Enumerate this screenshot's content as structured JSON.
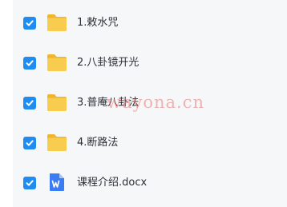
{
  "files": [
    {
      "name": "1.敕水咒",
      "type": "folder",
      "checked": true
    },
    {
      "name": "2.八卦镜开光",
      "type": "folder",
      "checked": true
    },
    {
      "name": "3.普庵八卦法",
      "type": "folder",
      "checked": true
    },
    {
      "name": "4.断路法",
      "type": "folder",
      "checked": true
    },
    {
      "name": "课程介绍.docx",
      "type": "word-document",
      "checked": true
    }
  ],
  "icons": {
    "folder": "folder-icon",
    "word_document": "word-document-icon",
    "check": "checkbox-checked-icon"
  },
  "colors": {
    "checkbox": "#1e8cf0",
    "folder": "#f7c948",
    "word": "#3b7cf4",
    "list_background": "#f6f7f9"
  },
  "watermark": "wayona.cn"
}
